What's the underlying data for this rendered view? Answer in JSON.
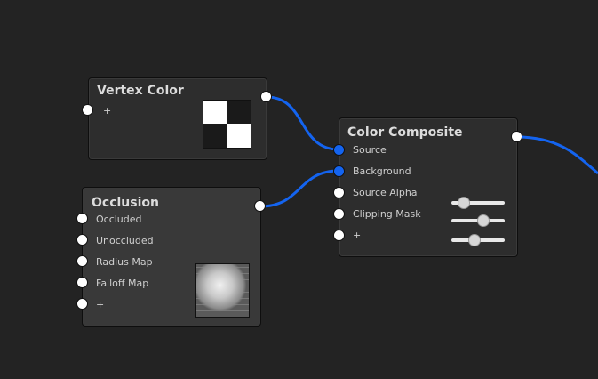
{
  "colors": {
    "background": "#232323",
    "node": "#2d2d2d",
    "node_selected": "#393939",
    "wire": "#1464f0",
    "port_connected": "#1464f0",
    "port_free": "#ffffff"
  },
  "nodes": {
    "vertex_color": {
      "title": "Vertex Color",
      "inputs": [
        "+"
      ],
      "thumbnail": "checker-thumbnail"
    },
    "occlusion": {
      "title": "Occlusion",
      "inputs": [
        "Occluded",
        "Unoccluded",
        "Radius Map",
        "Falloff Map",
        "+"
      ],
      "thumbnail": "occlusion-sphere-thumbnail"
    },
    "color_composite": {
      "title": "Color Composite",
      "inputs": [
        "Source",
        "Background",
        "Source Alpha",
        "Clipping Mask",
        "+"
      ],
      "sliders": [
        0.25,
        0.6,
        0.45
      ]
    }
  }
}
